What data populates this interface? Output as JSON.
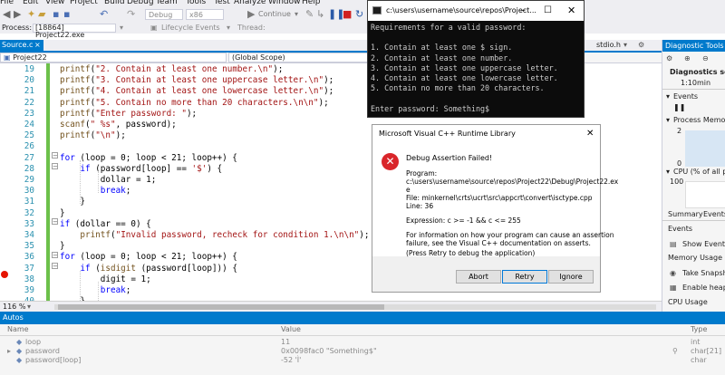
{
  "menu": [
    "File",
    "Edit",
    "View",
    "Project",
    "Build",
    "Debug",
    "Team",
    "Tools",
    "Test",
    "Analyze",
    "Window",
    "Help"
  ],
  "toolbar": {
    "config": "Debug",
    "platform": "x86",
    "continue_label": "Continue"
  },
  "process_bar": {
    "process_label": "Process:",
    "process_value": "[18864] Project22.exe",
    "lifecycle_label": "Lifecycle Events",
    "thread_label": "Thread:"
  },
  "tabs": {
    "active": "Source.c",
    "other": "stdio.h"
  },
  "navbar": {
    "project": "Project22",
    "scope": "(Global Scope)"
  },
  "editor": {
    "lines": [
      {
        "n": "19",
        "code": "printf(\"2. Contain at least one number.\\n\");"
      },
      {
        "n": "20",
        "code": "printf(\"3. Contain at least one uppercase letter.\\n\");"
      },
      {
        "n": "21",
        "code": "printf(\"4. Contain at least one lowercase letter.\\n\");"
      },
      {
        "n": "22",
        "code": "printf(\"5. Contain no more than 20 characters.\\n\\n\");"
      },
      {
        "n": "23",
        "code": "printf(\"Enter password: \");"
      },
      {
        "n": "24",
        "code": "scanf(\" %s\", password);"
      },
      {
        "n": "25",
        "code": "printf(\"\\n\");"
      },
      {
        "n": "26",
        "code": ""
      },
      {
        "n": "27",
        "code": "for (loop = 0; loop < 21; loop++) {"
      },
      {
        "n": "28",
        "code": "    if (password[loop] == '$') {"
      },
      {
        "n": "29",
        "code": "        dollar = 1;"
      },
      {
        "n": "30",
        "code": "        break;"
      },
      {
        "n": "31",
        "code": "    }"
      },
      {
        "n": "32",
        "code": "}"
      },
      {
        "n": "33",
        "code": "if (dollar == 0) {"
      },
      {
        "n": "34",
        "code": "    printf(\"Invalid password, recheck for condition 1.\\n\\n\");"
      },
      {
        "n": "35",
        "code": "}"
      },
      {
        "n": "36",
        "code": "for (loop = 0; loop < 21; loop++) {"
      },
      {
        "n": "37",
        "code": "    if (isdigit (password[loop])) {"
      },
      {
        "n": "38",
        "code": "        digit = 1;"
      },
      {
        "n": "39",
        "code": "        break;"
      },
      {
        "n": "40",
        "code": "    }"
      }
    ]
  },
  "zoom": "116 %",
  "diagnostics": {
    "title": "Diagnostic Tools",
    "session": "Diagnostics sessio",
    "time": "1:10min",
    "events": "Events",
    "process_memory": "Process Memory",
    "mem_max": "2",
    "mem_min": "0",
    "cpu": "CPU (% of all pro",
    "cpu_max": "100",
    "tab_summary": "Summary",
    "tab_events": "Events",
    "events_header": "Events",
    "show_events": "Show Events (",
    "memory_usage": "Memory Usage",
    "take_snapshot": "Take Snapsho",
    "enable_heap": "Enable heap p",
    "cpu_usage": "CPU Usage"
  },
  "autos": {
    "title": "Autos",
    "columns": [
      "Name",
      "Value",
      "Type"
    ],
    "rows": [
      {
        "name": "loop",
        "value": "11",
        "type": "int"
      },
      {
        "name": "password",
        "value": "0x0098fac0 \"Something$\"",
        "type": "char[21]"
      },
      {
        "name": "password[loop]",
        "value": "-52 'Ì'",
        "type": "char"
      }
    ]
  },
  "console": {
    "title": "c:\\users\\username\\source\\repos\\Project...",
    "lines": [
      "Requirements for a valid password:",
      "",
      "1. Contain at least one $ sign.",
      "2. Contain at least one number.",
      "3. Contain at least one uppercase letter.",
      "4. Contain at least one lowercase letter.",
      "5. Contain no more than 20 characters.",
      "",
      "Enter password: Something$"
    ]
  },
  "dialog": {
    "title": "Microsoft Visual C++ Runtime Library",
    "heading": "Debug Assertion Failed!",
    "program_label": "Program:",
    "program_path_1": "c:\\users\\username\\source\\repos\\Project22\\Debug\\Project22.ex",
    "program_path_2": "e",
    "file": "File: minkernel\\crts\\ucrt\\src\\appcrt\\convert\\isctype.cpp",
    "line": "Line: 36",
    "expression": "Expression: c >= -1 && c <= 255",
    "info_1": "For information on how your program can cause an assertion",
    "info_2": "failure, see the Visual C++ documentation on asserts.",
    "hint": "(Press Retry to debug the application)",
    "abort": "Abort",
    "retry": "Retry",
    "ignore": "Ignore"
  },
  "colors": {
    "accent": "#007acc",
    "error_icon": "#d9252a",
    "breakpoint": "#e51400",
    "changed_bar": "#6cc04a"
  }
}
